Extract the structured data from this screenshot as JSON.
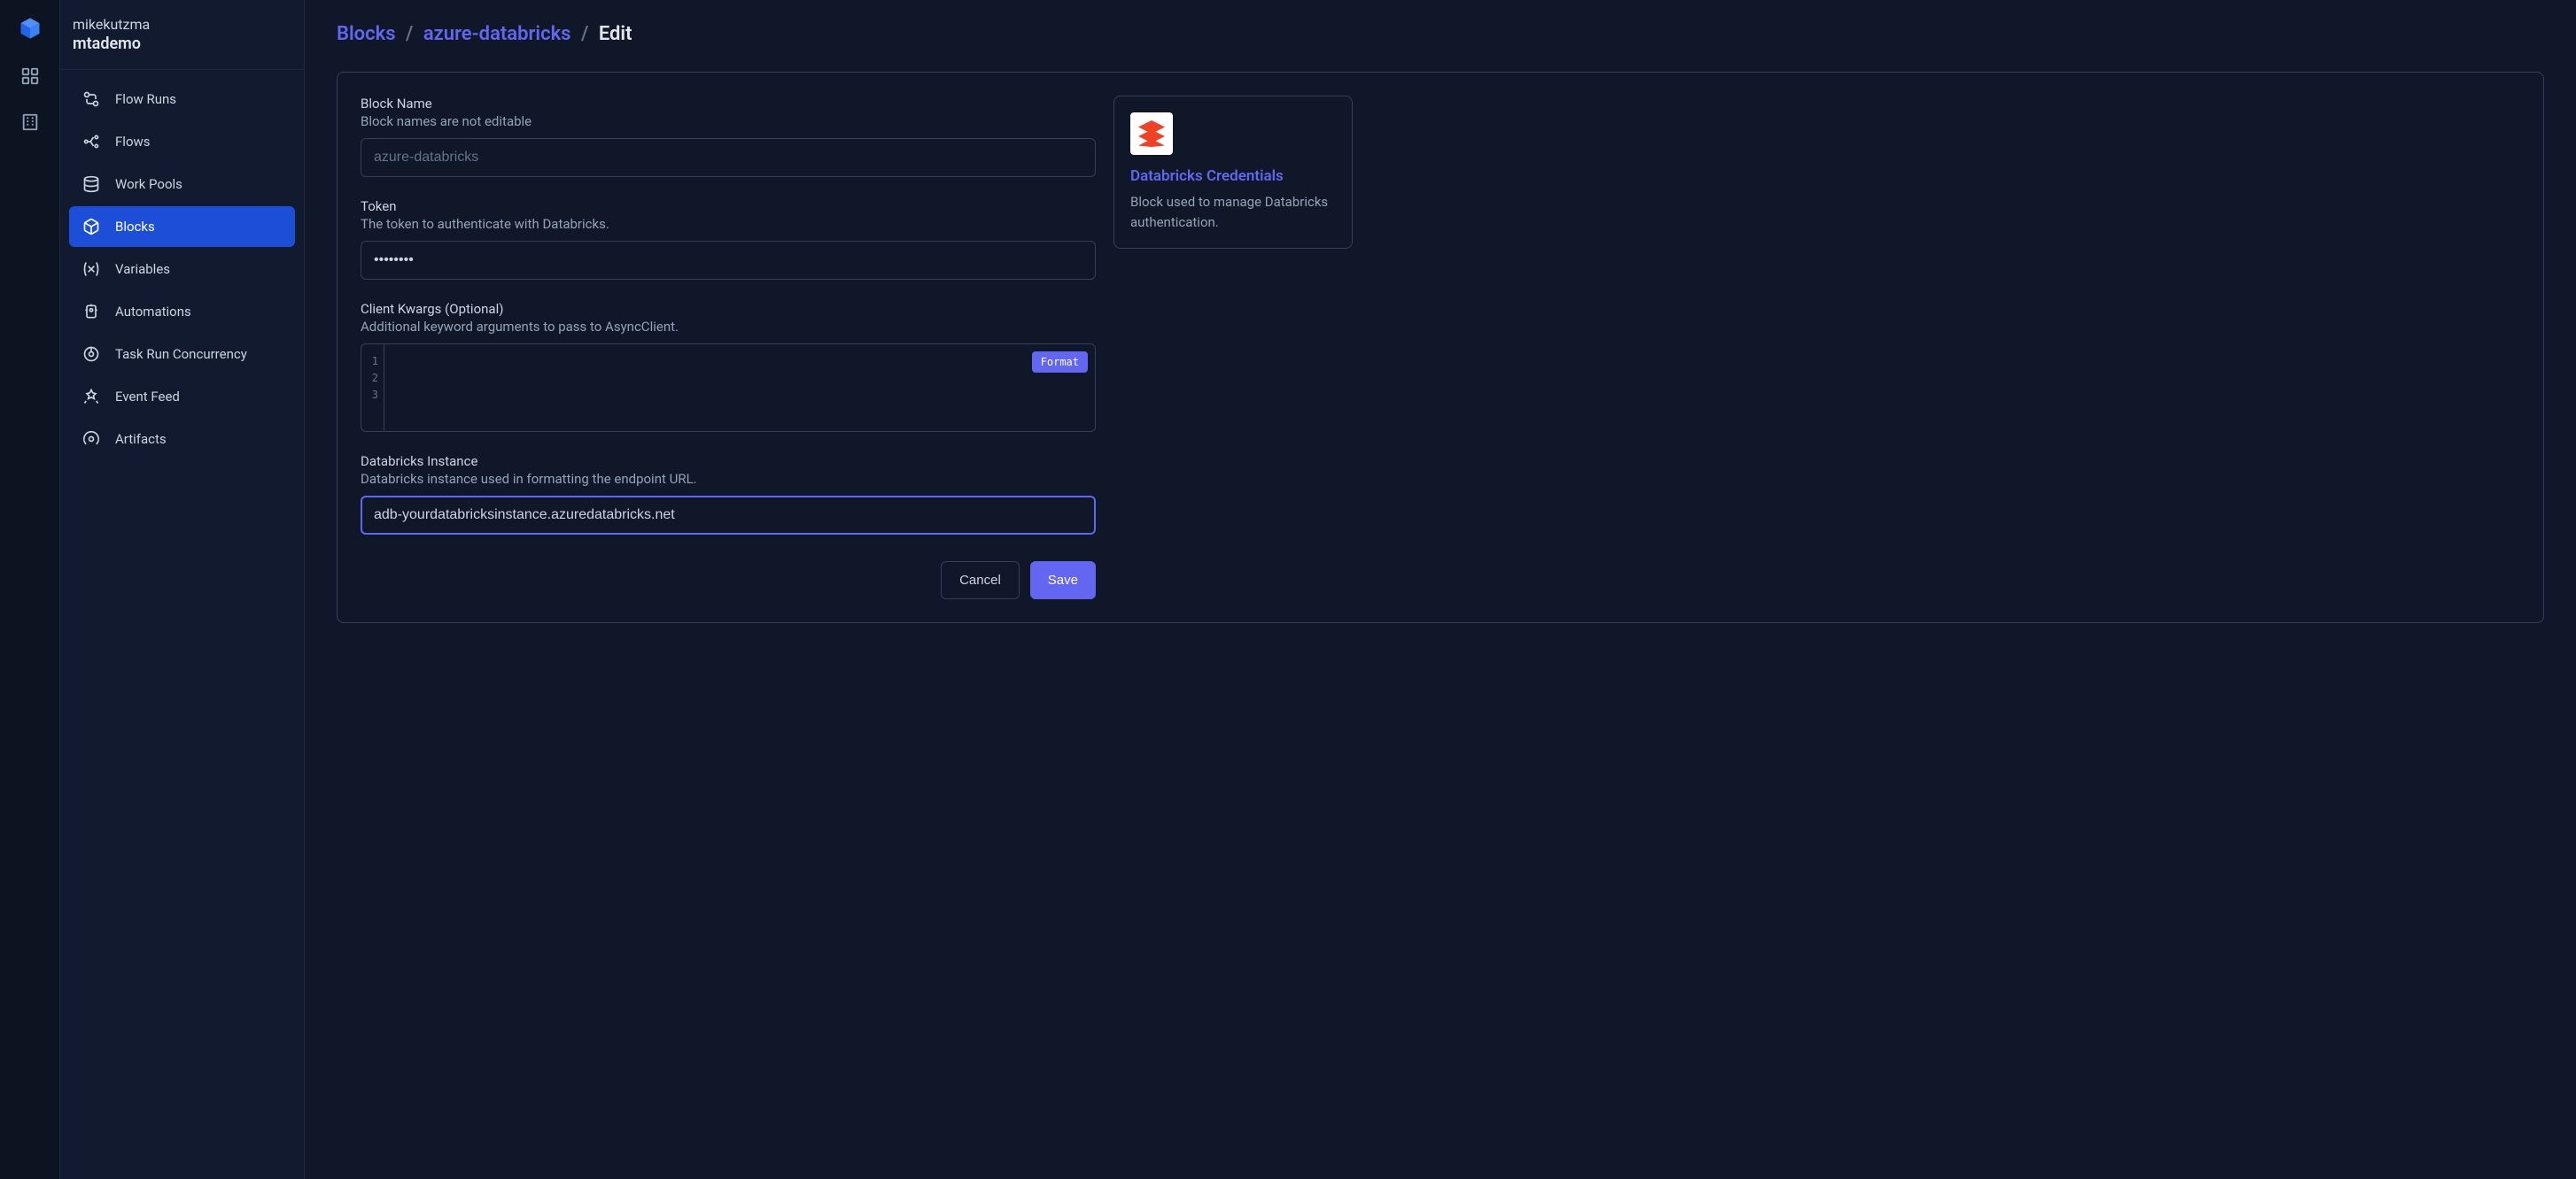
{
  "header": {
    "username": "mikekutzma",
    "workspace": "mtademo"
  },
  "sidebar": {
    "items": [
      {
        "label": "Flow Runs"
      },
      {
        "label": "Flows"
      },
      {
        "label": "Work Pools"
      },
      {
        "label": "Blocks"
      },
      {
        "label": "Variables"
      },
      {
        "label": "Automations"
      },
      {
        "label": "Task Run Concurrency"
      },
      {
        "label": "Event Feed"
      },
      {
        "label": "Artifacts"
      }
    ]
  },
  "breadcrumb": {
    "root": "Blocks",
    "item": "azure-databricks",
    "page": "Edit"
  },
  "form": {
    "blockName": {
      "label": "Block Name",
      "desc": "Block names are not editable",
      "value": "azure-databricks"
    },
    "token": {
      "label": "Token",
      "desc": "The token to authenticate with Databricks.",
      "value": "••••••••"
    },
    "clientKwargs": {
      "label": "Client Kwargs (Optional)",
      "desc": "Additional keyword arguments to pass to AsyncClient.",
      "formatLabel": "Format",
      "lines": [
        "1",
        "2",
        "3"
      ]
    },
    "instance": {
      "label": "Databricks Instance",
      "desc": "Databricks instance used in formatting the endpoint URL.",
      "value": "adb-yourdatabricksinstance.azuredatabricks.net"
    }
  },
  "actions": {
    "cancel": "Cancel",
    "save": "Save"
  },
  "infoCard": {
    "title": "Databricks Credentials",
    "desc": "Block used to manage Databricks authentication."
  }
}
